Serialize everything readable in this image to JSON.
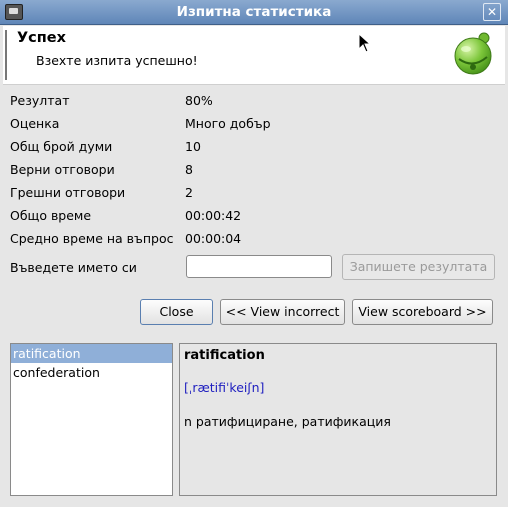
{
  "window": {
    "title": "Изпитна статистика",
    "close_glyph": "☒"
  },
  "header": {
    "title": "Успех",
    "subtitle": "Взехте изпита успешно!",
    "icon": "bell-icon"
  },
  "stats": [
    {
      "label": "Резултат",
      "value": "80%"
    },
    {
      "label": "Оценка",
      "value": "Много добър"
    },
    {
      "label": "Общ брой думи",
      "value": "10"
    },
    {
      "label": "Верни отговори",
      "value": "8"
    },
    {
      "label": "Грешни отговори",
      "value": "2"
    },
    {
      "label": "Общо време",
      "value": "00:00:42"
    },
    {
      "label": "Средно време на въпрос",
      "value": "00:00:04"
    }
  ],
  "name_entry": {
    "label": "Въведете името си",
    "value": "",
    "save_label": "Запишете резултата"
  },
  "buttons": {
    "close": "Close",
    "view_incorrect": "<< View incorrect",
    "view_scoreboard": "View scoreboard >>"
  },
  "words": [
    {
      "label": "ratification",
      "selected": true
    },
    {
      "label": "confederation",
      "selected": false
    }
  ],
  "definition": {
    "word": "ratification",
    "pronunciation": "[ˌrætifiˈkeiʃn]",
    "meaning": "n ратифициране, ратификация"
  }
}
